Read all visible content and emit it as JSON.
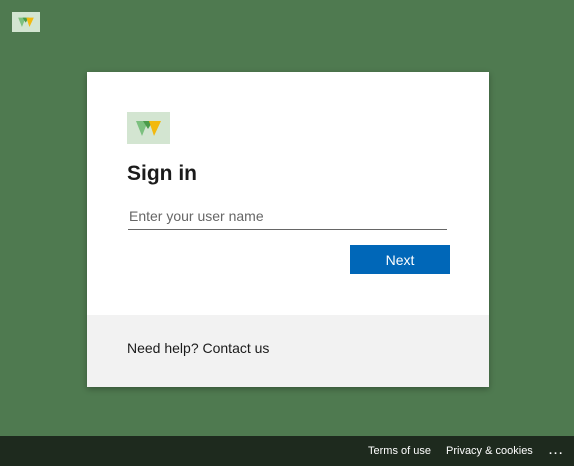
{
  "brand": {
    "colors": {
      "background": "#4f7a50",
      "accent": "#0067b8"
    }
  },
  "card": {
    "title": "Sign in",
    "username_placeholder": "Enter your user name",
    "username_value": "",
    "next_label": "Next",
    "help_text": "Need help? Contact us"
  },
  "footer": {
    "terms": "Terms of use",
    "privacy": "Privacy & cookies",
    "more": "..."
  }
}
